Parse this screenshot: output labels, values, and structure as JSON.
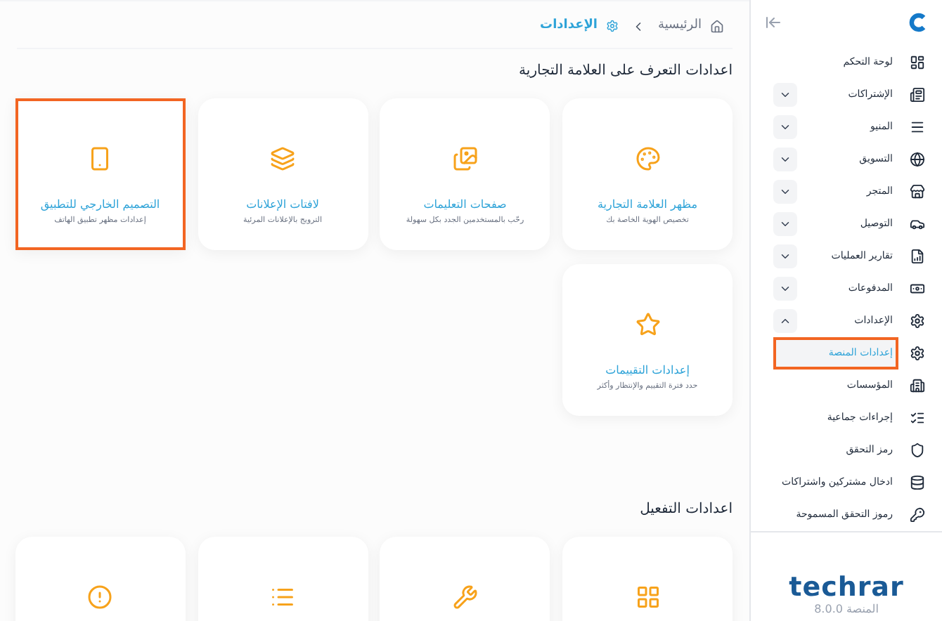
{
  "breadcrumb": {
    "home": "الرئيسية",
    "current": "الإعدادات"
  },
  "sections": [
    {
      "title": "اعدادات التعرف على العلامة التجارية",
      "cards": [
        {
          "title": "مظهر العلامة التجارية",
          "subtitle": "تخصيص الهوية الخاصة بك",
          "highlighted": false
        },
        {
          "title": "صفحات التعليمات",
          "subtitle": "رحّب بالمستخدمين الجدد بكل سهولة",
          "highlighted": false
        },
        {
          "title": "لافتات الإعلانات",
          "subtitle": "الترويج بالإعلانات المرئية",
          "highlighted": false
        },
        {
          "title": "التصميم الخارجي للتطبيق",
          "subtitle": "إعدادات مظهر تطبيق الهاتف",
          "highlighted": true
        },
        {
          "title": "إعدادات التقييمات",
          "subtitle": "حدد فترة التقييم والإنتظار وأكثر",
          "highlighted": false
        }
      ]
    },
    {
      "title": "اعدادات التفعيل",
      "cards": [
        {
          "highlighted": false
        },
        {
          "highlighted": false
        },
        {
          "highlighted": false
        },
        {
          "highlighted": false
        }
      ]
    }
  ],
  "sidebar": {
    "items": [
      {
        "label": "لوحة التحكم"
      },
      {
        "label": "الإشتراكات",
        "expanded": false
      },
      {
        "label": "المنيو",
        "expanded": false
      },
      {
        "label": "التسويق",
        "expanded": false
      },
      {
        "label": "المتجر",
        "expanded": false
      },
      {
        "label": "التوصيل",
        "expanded": false
      },
      {
        "label": "تقارير العمليات",
        "expanded": false
      },
      {
        "label": "المدفوعات",
        "expanded": false
      },
      {
        "label": "الإعدادات",
        "expanded": true,
        "children": [
          {
            "label": "إعدادات المنصة",
            "selected": true,
            "highlighted": true
          },
          {
            "label": "المؤسسات",
            "selected": false,
            "highlighted": false
          },
          {
            "label": "إجراءات جماعية",
            "selected": false,
            "highlighted": false
          },
          {
            "label": "رمز التحقق",
            "selected": false,
            "highlighted": false
          },
          {
            "label": "ادخال مشتركين واشتراكات",
            "selected": false,
            "highlighted": false
          },
          {
            "label": "رموز التحقق المسموحة",
            "selected": false,
            "highlighted": false
          }
        ]
      }
    ]
  },
  "brand": {
    "logo": "techrar",
    "version": "المنصة 8.0.0"
  }
}
